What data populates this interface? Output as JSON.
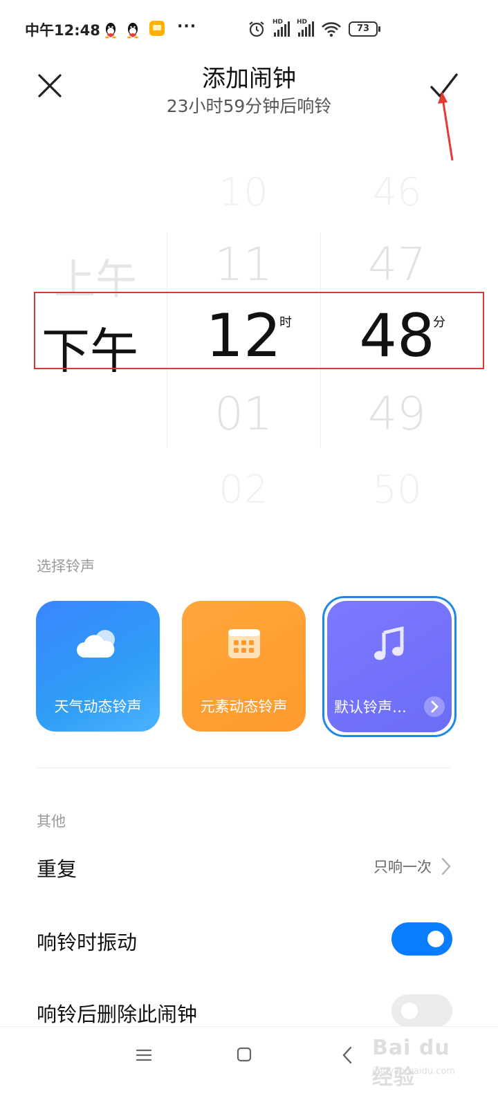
{
  "status_bar": {
    "time": "中午12:48",
    "more": "···",
    "battery": "73",
    "hd_1": "HD",
    "hd_2": "HD"
  },
  "header": {
    "title": "添加闹钟",
    "subtitle": "23小时59分钟后响铃"
  },
  "picker": {
    "ampm": {
      "above": "上午",
      "selected": "下午"
    },
    "hour": {
      "above2": "10",
      "above1": "11",
      "selected": "12",
      "below1": "01",
      "below2": "02",
      "unit": "时"
    },
    "minute": {
      "above2": "46",
      "above1": "47",
      "selected": "48",
      "below1": "49",
      "below2": "50",
      "unit": "分"
    }
  },
  "ringtone": {
    "section_label": "选择铃声",
    "cards": [
      {
        "label": "天气动态铃声",
        "icon": "cloud-icon"
      },
      {
        "label": "元素动态铃声",
        "icon": "calendar-grid-icon"
      },
      {
        "label": "默认铃声…",
        "icon": "music-note-icon"
      }
    ]
  },
  "other": {
    "section_label": "其他",
    "repeat": {
      "label": "重复",
      "value": "只响一次"
    },
    "vibrate": {
      "label": "响铃时振动",
      "on": true
    },
    "delete_after": {
      "label": "响铃后删除此闹钟",
      "on": false
    }
  },
  "watermark": {
    "text": "Bai du 经验",
    "sub": "jingyan.baidu.com"
  },
  "colors": {
    "accent": "#0a7cff",
    "annotation": "#d93636",
    "card_weather": "#3a86ff",
    "card_element": "#ffa63a",
    "card_default": "#7b79ff"
  }
}
